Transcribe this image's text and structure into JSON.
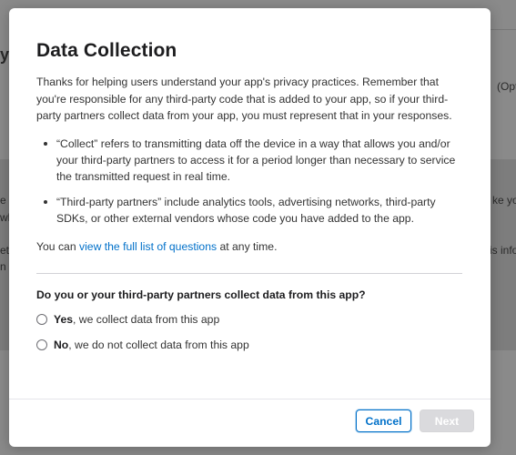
{
  "background": {
    "fragment_y": "y",
    "fragment_opt": "(Opt",
    "fragment_l1": "e",
    "fragment_l2": "wh",
    "fragment_l3": "et",
    "fragment_l4": "n s",
    "fragment_r1": "ke you",
    "fragment_r2": "is info"
  },
  "modal": {
    "title": "Data Collection",
    "intro": "Thanks for helping users understand your app's privacy practices. Remember that you're responsible for any third-party code that is added to your app, so if your third-party partners collect data from your app, you must represent that in your responses.",
    "bullets": [
      "“Collect” refers to transmitting data off the device in a way that allows you and/or your third-party partners to access it for a period longer than necessary to service the transmitted request in real time.",
      "“Third-party partners” include analytics tools, advertising networks, third-party SDKs, or other external vendors whose code you have added to the app."
    ],
    "questions_prefix": "You can ",
    "questions_link": "view the full list of questions",
    "questions_suffix": " at any time.",
    "question": "Do you or your third-party partners collect data from this app?",
    "option_yes_bold": "Yes",
    "option_yes_rest": ", we collect data from this app",
    "option_no_bold": "No",
    "option_no_rest": ", we do not collect data from this app",
    "cancel_label": "Cancel",
    "next_label": "Next"
  },
  "colors": {
    "link": "#0070c9",
    "overlay": "#8f8f8f",
    "disabled_button": "#dadadd"
  }
}
